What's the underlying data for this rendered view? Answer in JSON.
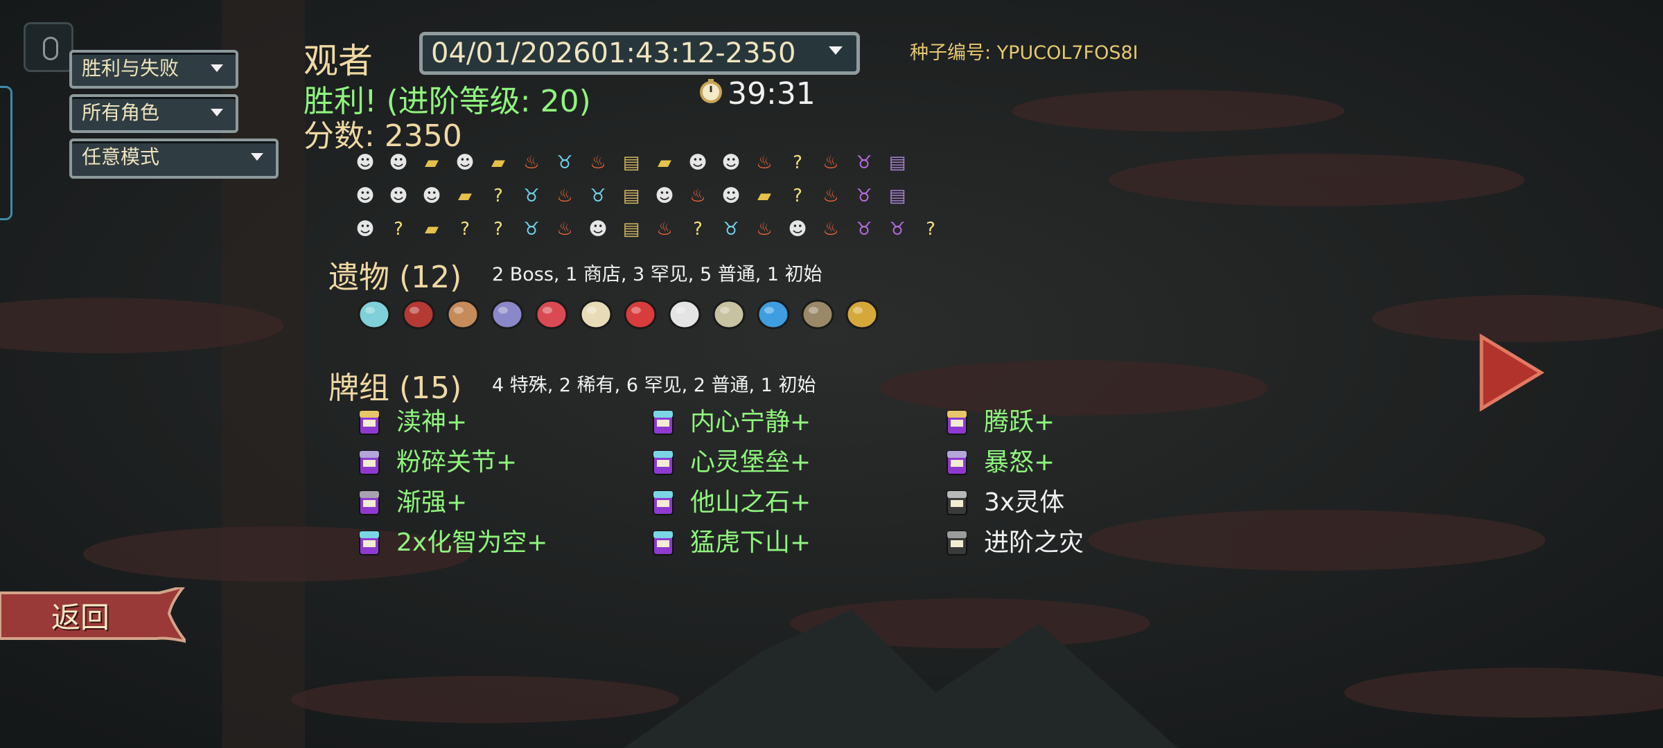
{
  "filters": [
    {
      "label": "胜利与失败"
    },
    {
      "label": "所有角色"
    },
    {
      "label": "任意模式"
    }
  ],
  "character": "观者",
  "run_select": {
    "value": "04/01/202601:43:12-2350"
  },
  "seed": {
    "text": "种子编号: YPUCOL7FOS8I"
  },
  "result": "胜利! (进阶等级: 20)",
  "timer": "39:31",
  "score": "分数: 2350",
  "path_rows": [
    [
      "monster",
      "monster",
      "treasure",
      "monster",
      "treasure",
      "elite",
      "boss",
      "elite",
      "shop",
      "treasure",
      "monster",
      "monster",
      "elite",
      "unknown",
      "elite",
      "boss2",
      "chest"
    ],
    [
      "monster",
      "monster",
      "monster",
      "treasure",
      "unknown",
      "boss",
      "elite",
      "boss",
      "shop",
      "monster",
      "elite",
      "monster",
      "treasure",
      "unknown",
      "elite",
      "boss2",
      "chest"
    ],
    [
      "monster",
      "unknown",
      "treasure",
      "unknown-pct",
      "unknown",
      "boss",
      "elite",
      "monster",
      "shop",
      "elite",
      "unknown-pct",
      "boss",
      "elite",
      "monster",
      "elite",
      "boss2",
      "boss2",
      "unknown"
    ]
  ],
  "relics": {
    "title": "遗物 (12)",
    "summary": "2  Boss, 1  商店, 3  罕见, 5  普通, 1  初始",
    "items": [
      "teardrop-locket-icon",
      "nunchaku-icon",
      "meat-on-bone-icon",
      "shell-icon",
      "red-pouch-icon",
      "egg-icon",
      "strawberry-icon",
      "elephant-icon",
      "birdcage-icon",
      "ink-bottle-icon",
      "wooden-plank-icon",
      "sunflower-pot-icon"
    ]
  },
  "deck": {
    "title": "牌组 (15)",
    "summary": "4  特殊, 2  稀有, 6  罕见, 2  普通, 1  初始",
    "cards": [
      {
        "name": "渎神+",
        "rarity": "rare",
        "color": "green"
      },
      {
        "name": "内心宁静+",
        "rarity": "uncommon",
        "color": "green"
      },
      {
        "name": "腾跃+",
        "rarity": "rare",
        "color": "green"
      },
      {
        "name": "粉碎关节+",
        "rarity": "common",
        "color": "green"
      },
      {
        "name": "心灵堡垒+",
        "rarity": "uncommon",
        "color": "green"
      },
      {
        "name": "暴怒+",
        "rarity": "common",
        "color": "green"
      },
      {
        "name": "渐强+",
        "rarity": "special",
        "color": "green"
      },
      {
        "name": "他山之石+",
        "rarity": "uncommon",
        "color": "green"
      },
      {
        "name": "3x灵体",
        "rarity": "colorless",
        "color": "white"
      },
      {
        "name": "2x化智为空+",
        "rarity": "uncommon",
        "color": "green"
      },
      {
        "name": "猛虎下山+",
        "rarity": "uncommon",
        "color": "green"
      },
      {
        "name": "进阶之灾",
        "rarity": "curse",
        "color": "white"
      }
    ]
  },
  "return_label": "返回",
  "colors": {
    "gold": "#efd9a3",
    "green": "#8ff57d",
    "seed": "#e6c86f"
  }
}
